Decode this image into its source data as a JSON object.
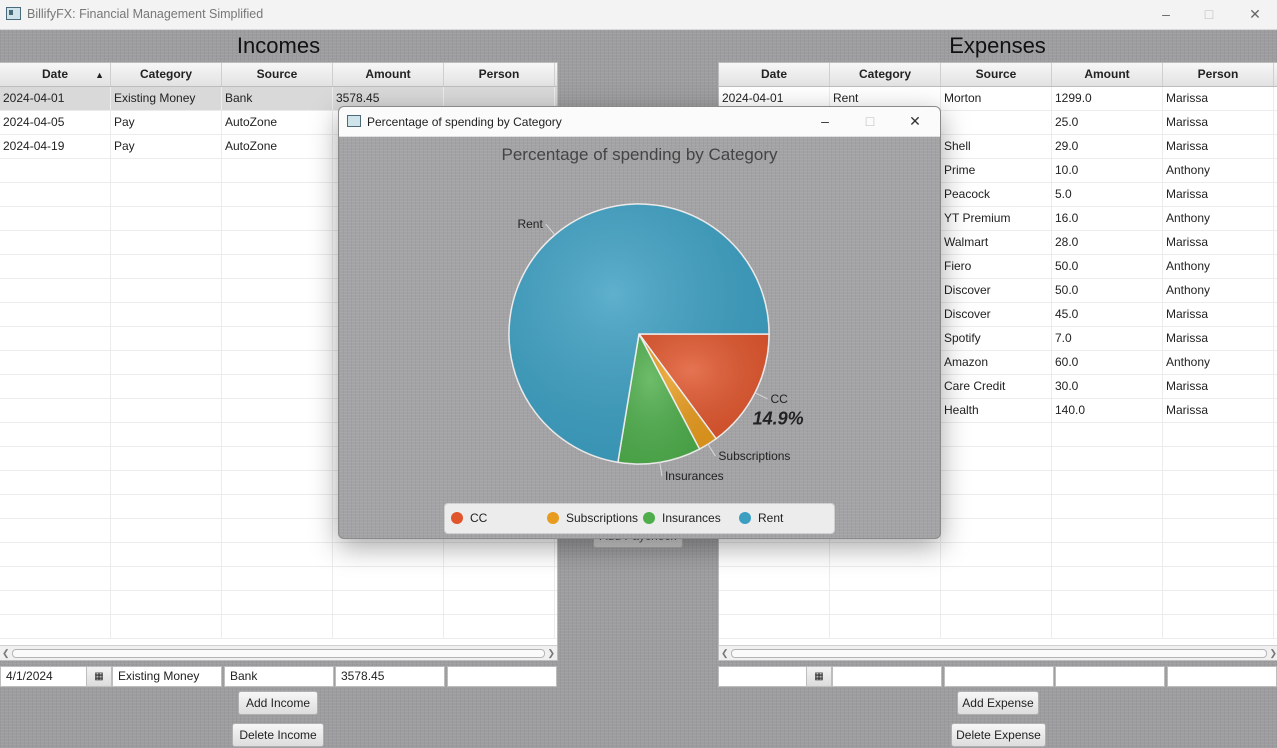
{
  "app": {
    "title": "BillifyFX: Financial Management Simplified"
  },
  "incomes": {
    "title": "Incomes",
    "columns": [
      "Date",
      "Category",
      "Source",
      "Amount",
      "Person"
    ],
    "rows": [
      [
        "2024-04-01",
        "Existing Money",
        "Bank",
        "3578.45",
        ""
      ],
      [
        "2024-04-05",
        "Pay",
        "AutoZone",
        "",
        ""
      ],
      [
        "2024-04-19",
        "Pay",
        "AutoZone",
        "",
        ""
      ]
    ],
    "form": {
      "date": "4/1/2024",
      "category": "Existing Money",
      "source": "Bank",
      "amount": "3578.45",
      "person": ""
    },
    "add_label": "Add Income",
    "delete_label": "Delete Income"
  },
  "expenses": {
    "title": "Expenses",
    "columns": [
      "Date",
      "Category",
      "Source",
      "Amount",
      "Person"
    ],
    "rows": [
      [
        "2024-04-01",
        "Rent",
        "Morton",
        "1299.0",
        "Marissa"
      ],
      [
        "",
        "",
        "",
        "25.0",
        "Marissa"
      ],
      [
        "",
        "",
        "Shell",
        "29.0",
        "Marissa"
      ],
      [
        "",
        "",
        "Prime",
        "10.0",
        "Anthony"
      ],
      [
        "",
        "",
        "Peacock",
        "5.0",
        "Marissa"
      ],
      [
        "",
        "",
        "YT Premium",
        "16.0",
        "Anthony"
      ],
      [
        "",
        "",
        "Walmart",
        "28.0",
        "Marissa"
      ],
      [
        "",
        "",
        "Fiero",
        "50.0",
        "Anthony"
      ],
      [
        "",
        "",
        "Discover",
        "50.0",
        "Anthony"
      ],
      [
        "",
        "",
        "Discover",
        "45.0",
        "Marissa"
      ],
      [
        "",
        "",
        "Spotify",
        "7.0",
        "Marissa"
      ],
      [
        "",
        "",
        "Amazon",
        "60.0",
        "Anthony"
      ],
      [
        "",
        "",
        "Care Credit",
        "30.0",
        "Marissa"
      ],
      [
        "",
        "",
        "Health",
        "140.0",
        "Marissa"
      ]
    ],
    "form": {
      "date": "",
      "category": "",
      "source": "",
      "amount": "",
      "person": ""
    },
    "add_label": "Add Expense",
    "delete_label": "Delete Expense"
  },
  "middle": {
    "add_paycheck_label": "Add Paycheck"
  },
  "dialog": {
    "title": "Percentage of spending by Category"
  },
  "chart_data": {
    "type": "pie",
    "title": "Percentage of spending by Category",
    "slices": [
      {
        "label": "CC",
        "value": 14.9,
        "color": "#e0552c"
      },
      {
        "label": "Subscriptions",
        "value": 2.4,
        "color": "#e89c1e"
      },
      {
        "label": "Insurances",
        "value": 10.3,
        "color": "#4eae4b"
      },
      {
        "label": "Rent",
        "value": 72.4,
        "color": "#3b9fc2"
      }
    ],
    "highlighted_label": "14.9%",
    "legend": [
      "CC",
      "Subscriptions",
      "Insurances",
      "Rent"
    ],
    "legend_position": "bottom"
  }
}
